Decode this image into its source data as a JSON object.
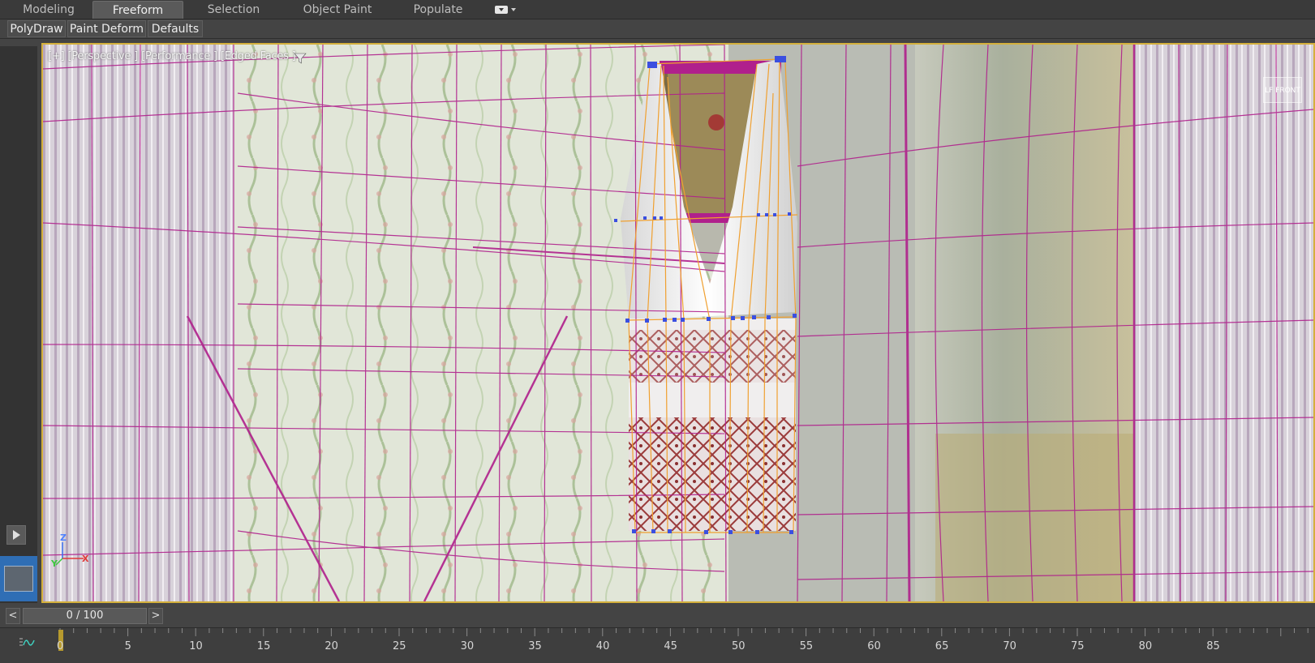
{
  "ribbon": {
    "tabs": [
      {
        "label": "Modeling",
        "active": false
      },
      {
        "label": "Freeform",
        "active": true
      },
      {
        "label": "Selection",
        "active": false
      },
      {
        "label": "Object Paint",
        "active": false
      },
      {
        "label": "Populate",
        "active": false
      }
    ],
    "overflow_icon": "chevron-down-icon"
  },
  "panels": {
    "buttons": [
      "PolyDraw",
      "Paint Deform",
      "Defaults"
    ]
  },
  "viewport": {
    "label": "[+] [Perspective ] [Performance ] [Edged Faces ]",
    "filter_icon": "filter-icon",
    "viewcube_label": "LF FRONT",
    "axis": {
      "z": "Z",
      "y": "Y",
      "x": "X"
    }
  },
  "timeline": {
    "prev": "<",
    "next": ">",
    "frame_display": "0 / 100"
  },
  "trackbar": {
    "ticks": [
      "0",
      "5",
      "10",
      "15",
      "20",
      "25",
      "30",
      "35",
      "40",
      "45",
      "50",
      "55",
      "60",
      "65",
      "70",
      "75",
      "80",
      "85"
    ]
  },
  "colors": {
    "accent": "#d4b03c",
    "wireframe": "#b0208c",
    "selection": "#f0a030",
    "vertex": "#3b4fe0"
  }
}
